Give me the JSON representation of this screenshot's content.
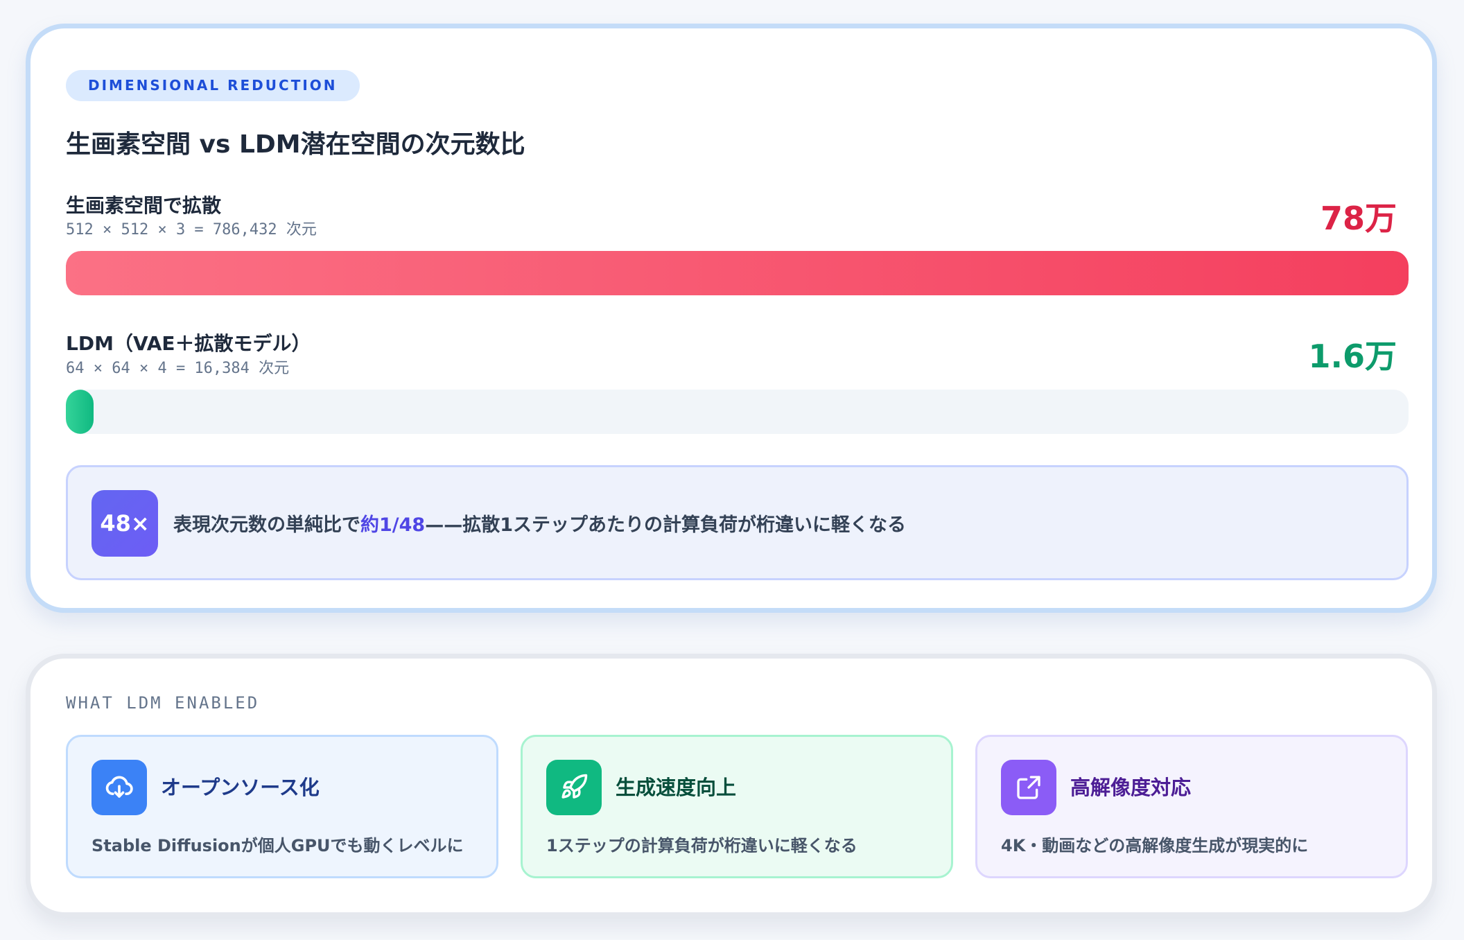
{
  "comparison": {
    "tag": "DIMENSIONAL REDUCTION",
    "title": "生画素空間 vs LDM潜在空間の次元数比",
    "rows": [
      {
        "label": "生画素空間で拡散",
        "formula": "512 × 512 × 3 = 786,432 次元",
        "value_label": "78万",
        "dimensions": 786432,
        "color": "#f43f5e"
      },
      {
        "label": "LDM（VAE＋拡散モデル）",
        "formula": "64 × 64 × 4 = 16,384 次元",
        "value_label": "1.6万",
        "dimensions": 16384,
        "color": "#10b981"
      }
    ],
    "ratio_badge": "48×",
    "summary": {
      "before": "表現次元数の単純比で",
      "highlight": "約1/48",
      "after": "——拡散1ステップあたりの計算負荷が桁違いに軽くなる"
    }
  },
  "enabled": {
    "section_label": "WHAT LDM ENABLED",
    "features": [
      {
        "icon": "cloud-download-icon",
        "title": "オープンソース化",
        "desc": "Stable Diffusionが個人GPUでも動くレベルに",
        "color": "#3b82f6"
      },
      {
        "icon": "rocket-icon",
        "title": "生成速度向上",
        "desc": "1ステップの計算負荷が桁違いに軽くなる",
        "color": "#10b981"
      },
      {
        "icon": "expand-icon",
        "title": "高解像度対応",
        "desc": "4K・動画などの高解像度生成が現実的に",
        "color": "#8b5cf6"
      }
    ]
  }
}
